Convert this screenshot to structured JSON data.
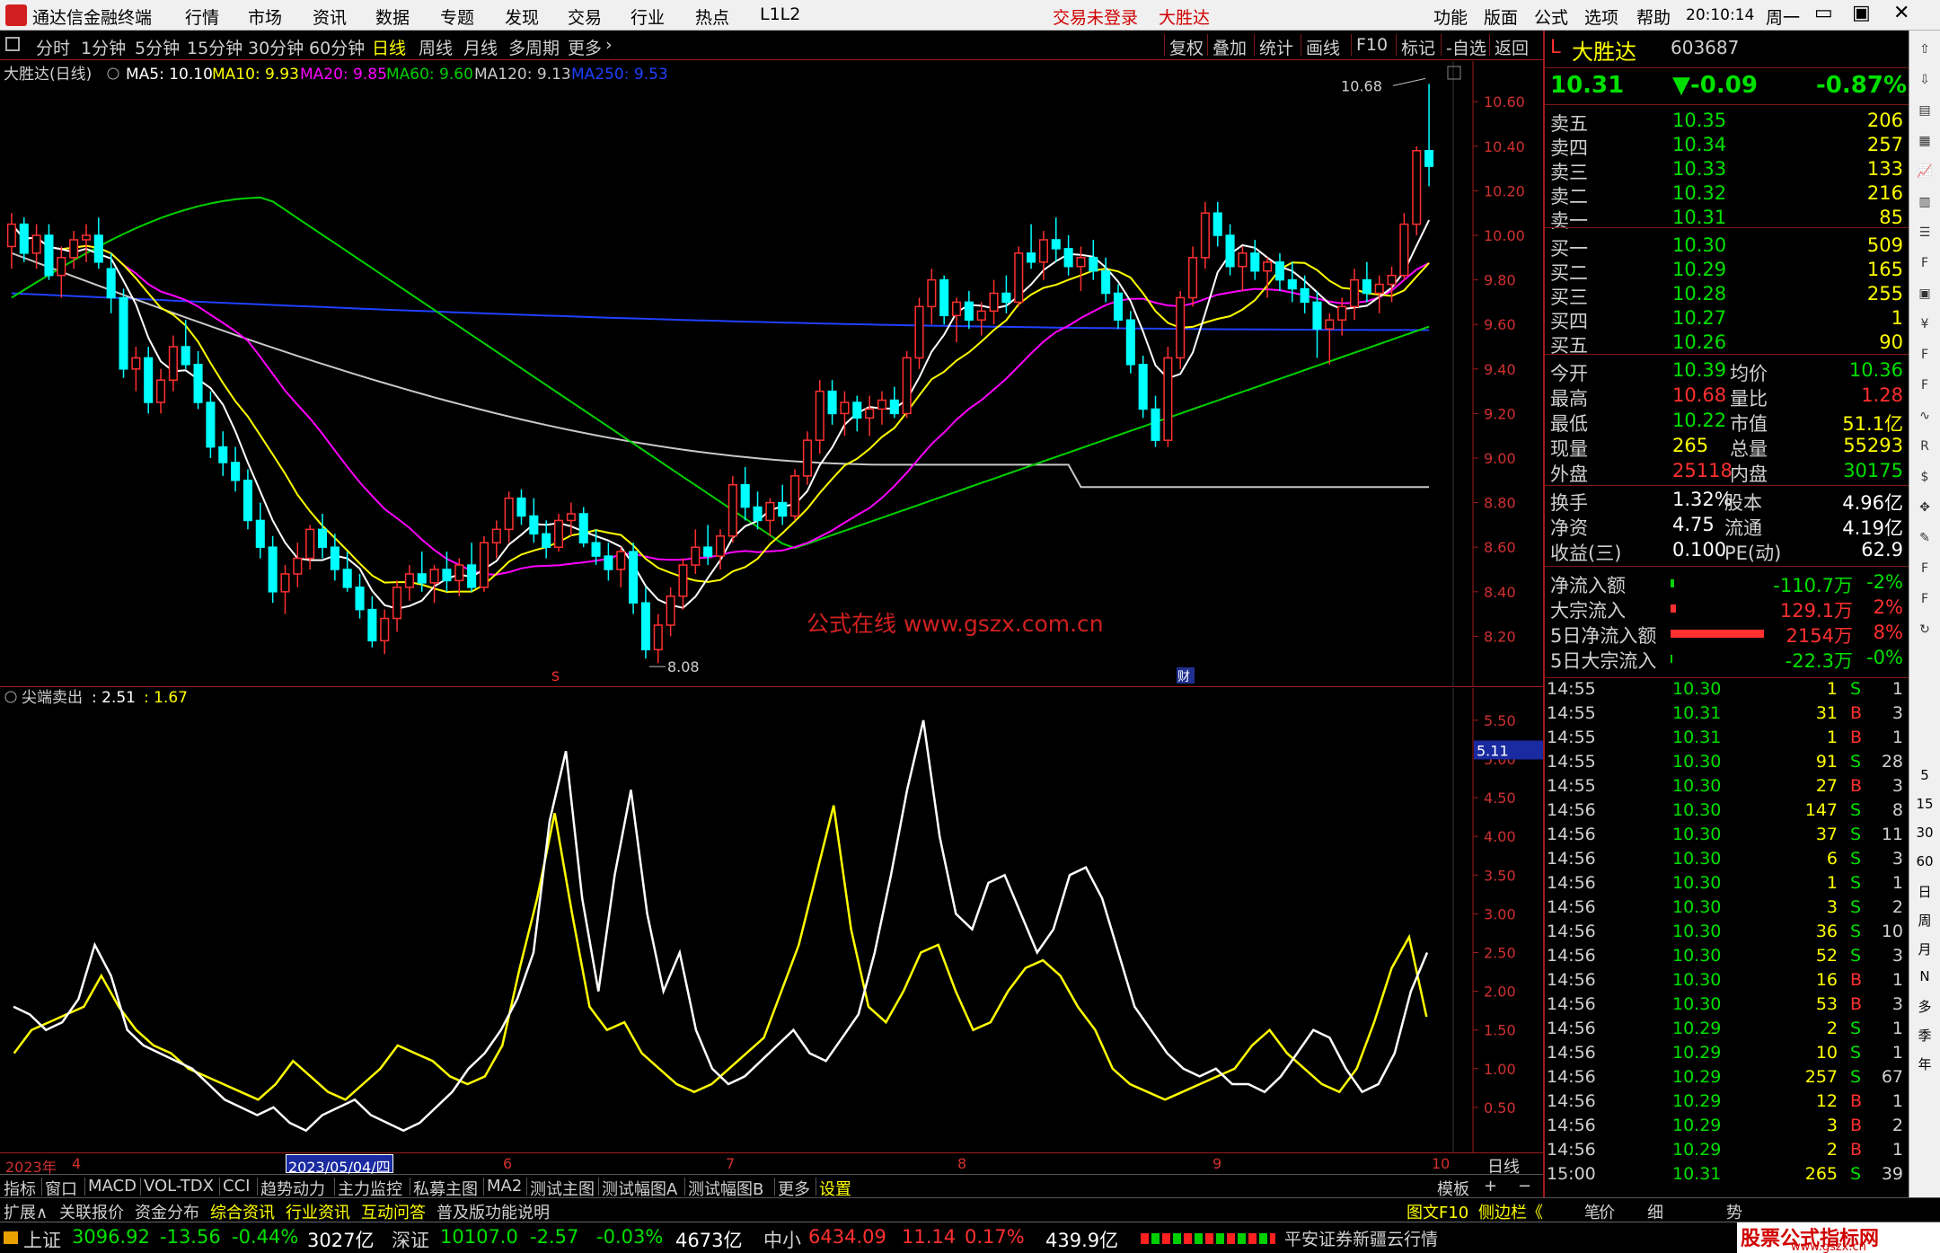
{
  "menubar": {
    "app_title": "通达信金融终端",
    "items": [
      "行情",
      "市场",
      "资讯",
      "数据",
      "专题",
      "发现",
      "交易",
      "行业",
      "热点",
      "L1L2"
    ],
    "status_login": "交易未登录",
    "status_stock": "大胜达",
    "right_items": [
      "功能",
      "版面",
      "公式",
      "选项",
      "帮助"
    ],
    "clock": "20:10:14",
    "weekday": "周一",
    "win_min": "▭",
    "win_max": "▣",
    "win_close": "✕"
  },
  "periodbar": {
    "tabs": [
      "分时",
      "1分钟",
      "5分钟",
      "15分钟",
      "30分钟",
      "60分钟",
      "日线",
      "周线",
      "月线",
      "多周期",
      "更多"
    ],
    "active_index": 6,
    "right_tabs": [
      "复权",
      "叠加",
      "统计",
      "画线",
      "F10",
      "标记",
      "-自选",
      "返回"
    ]
  },
  "main_chart": {
    "legend": {
      "title": "大胜达(日线)",
      "ma5": "MA5: 10.10",
      "ma10": "MA10: 9.93",
      "ma20": "MA20: 9.85",
      "ma60": "MA60: 9.60",
      "ma120": "MA120: 9.13",
      "ma250": "MA250: 9.53"
    },
    "high_label": "10.68",
    "low_label": "8.08",
    "watermark": "公式在线 www.gszx.com.cn",
    "marker_s": "S",
    "marker_cai": "财",
    "y_ticks": [
      "10.60",
      "10.40",
      "10.20",
      "10.00",
      "9.80",
      "9.60",
      "9.40",
      "9.20",
      "9.00",
      "8.80",
      "8.60",
      "8.40",
      "8.20"
    ]
  },
  "indicator": {
    "legend_name": "尖端卖出",
    "legend_v1": ": 2.51",
    "legend_v2": ": 1.67",
    "current_value": "5.11",
    "y_ticks": [
      "5.50",
      "5.00",
      "4.50",
      "4.00",
      "3.50",
      "3.00",
      "2.50",
      "2.00",
      "1.50",
      "1.00",
      "0.50"
    ]
  },
  "xaxis": {
    "labels": [
      "2023年",
      "4",
      "2023/05/04/四",
      "6",
      "7",
      "8",
      "9",
      "10"
    ],
    "period": "日线"
  },
  "bottom_tabs": {
    "items": [
      "指标",
      "窗口",
      "MACD",
      "VOL-TDX",
      "CCI",
      "趋势动力",
      "主力监控",
      "私募主图",
      "MA2",
      "测试主图",
      "测试幅图A",
      "测试幅图B",
      "更多",
      "设置"
    ],
    "right_items": [
      "模板",
      "+",
      "−"
    ]
  },
  "info_tabs": {
    "items": [
      "扩展∧",
      "关联报价",
      "资金分布",
      "综合资讯",
      "行业资讯",
      "互动问答",
      "普及版功能说明"
    ],
    "right_items": [
      "图文F10",
      "侧边栏《",
      "笔",
      "价",
      "细",
      "势"
    ]
  },
  "statusbar": {
    "sh_name": "上证",
    "sh_val": "3096.92",
    "sh_chg": "-13.56",
    "sh_pct": "-0.44%",
    "sh_amt": "3027亿",
    "sz_name": "深证",
    "sz_val": "10107.0",
    "sz_chg": "-2.57",
    "sz_pct": "-0.03%",
    "sz_amt": "4673亿",
    "zx_name": "中小",
    "zx_val": "6434.09",
    "zx_chg": "11.14",
    "zx_pct": "0.17%",
    "zx_amt": "439.9亿",
    "broker": "平安证券新疆云行情",
    "brand": "股票公式指标网",
    "brand_url": "www.gszx.cn"
  },
  "quote": {
    "flag": "L",
    "name": "大胜达",
    "code": "603687",
    "price": "10.31",
    "change": "▼-0.09",
    "pct": "-0.87%",
    "asks": [
      {
        "label": "卖五",
        "price": "10.35",
        "vol": "206"
      },
      {
        "label": "卖四",
        "price": "10.34",
        "vol": "257"
      },
      {
        "label": "卖三",
        "price": "10.33",
        "vol": "133"
      },
      {
        "label": "卖二",
        "price": "10.32",
        "vol": "216"
      },
      {
        "label": "卖一",
        "price": "10.31",
        "vol": "85"
      }
    ],
    "bids": [
      {
        "label": "买一",
        "price": "10.30",
        "vol": "509"
      },
      {
        "label": "买二",
        "price": "10.29",
        "vol": "165"
      },
      {
        "label": "买三",
        "price": "10.28",
        "vol": "255"
      },
      {
        "label": "买四",
        "price": "10.27",
        "vol": "1"
      },
      {
        "label": "买五",
        "price": "10.26",
        "vol": "90"
      }
    ],
    "stats": [
      {
        "l1": "今开",
        "v1": "10.39",
        "l2": "均价",
        "v2": "10.36"
      },
      {
        "l1": "最高",
        "v1": "10.68",
        "l2": "量比",
        "v2": "1.28"
      },
      {
        "l1": "最低",
        "v1": "10.22",
        "l2": "市值",
        "v2": "51.1亿"
      },
      {
        "l1": "现量",
        "v1": "265",
        "l2": "总量",
        "v2": "55293"
      },
      {
        "l1": "外盘",
        "v1": "25118",
        "l2": "内盘",
        "v2": "30175"
      }
    ],
    "fund": [
      {
        "l1": "换手",
        "v1": "1.32%",
        "l2": "股本",
        "v2": "4.96亿"
      },
      {
        "l1": "净资",
        "v1": "4.75",
        "l2": "流通",
        "v2": "4.19亿"
      },
      {
        "l1": "收益(三)",
        "v1": "0.100",
        "l2": "PE(动)",
        "v2": "62.9"
      }
    ],
    "flows": [
      {
        "label": "净流入额",
        "value": "-110.7万",
        "pct": "-2%"
      },
      {
        "label": "大宗流入",
        "value": "129.1万",
        "pct": "2%"
      },
      {
        "label": "5日净流入额",
        "value": "2154万",
        "pct": "8%"
      },
      {
        "label": "5日大宗流入",
        "value": "-22.3万",
        "pct": "-0%"
      }
    ]
  },
  "ticks": [
    {
      "t": "14:55",
      "p": "10.30",
      "v": "1",
      "bs": "S",
      "n": "1"
    },
    {
      "t": "14:55",
      "p": "10.31",
      "v": "31",
      "bs": "B",
      "n": "3"
    },
    {
      "t": "14:55",
      "p": "10.31",
      "v": "1",
      "bs": "B",
      "n": "1"
    },
    {
      "t": "14:55",
      "p": "10.30",
      "v": "91",
      "bs": "S",
      "n": "28"
    },
    {
      "t": "14:55",
      "p": "10.30",
      "v": "27",
      "bs": "B",
      "n": "3"
    },
    {
      "t": "14:56",
      "p": "10.30",
      "v": "147",
      "bs": "S",
      "n": "8"
    },
    {
      "t": "14:56",
      "p": "10.30",
      "v": "37",
      "bs": "S",
      "n": "11"
    },
    {
      "t": "14:56",
      "p": "10.30",
      "v": "6",
      "bs": "S",
      "n": "3"
    },
    {
      "t": "14:56",
      "p": "10.30",
      "v": "1",
      "bs": "S",
      "n": "1"
    },
    {
      "t": "14:56",
      "p": "10.30",
      "v": "3",
      "bs": "S",
      "n": "2"
    },
    {
      "t": "14:56",
      "p": "10.30",
      "v": "36",
      "bs": "S",
      "n": "10"
    },
    {
      "t": "14:56",
      "p": "10.30",
      "v": "52",
      "bs": "S",
      "n": "3"
    },
    {
      "t": "14:56",
      "p": "10.30",
      "v": "16",
      "bs": "B",
      "n": "1"
    },
    {
      "t": "14:56",
      "p": "10.30",
      "v": "53",
      "bs": "B",
      "n": "3"
    },
    {
      "t": "14:56",
      "p": "10.29",
      "v": "2",
      "bs": "S",
      "n": "1"
    },
    {
      "t": "14:56",
      "p": "10.29",
      "v": "10",
      "bs": "S",
      "n": "1"
    },
    {
      "t": "14:56",
      "p": "10.29",
      "v": "257",
      "bs": "S",
      "n": "67"
    },
    {
      "t": "14:56",
      "p": "10.29",
      "v": "12",
      "bs": "B",
      "n": "1"
    },
    {
      "t": "14:56",
      "p": "10.29",
      "v": "3",
      "bs": "B",
      "n": "2"
    },
    {
      "t": "14:56",
      "p": "10.29",
      "v": "2",
      "bs": "B",
      "n": "1"
    },
    {
      "t": "15:00",
      "p": "10.31",
      "v": "265",
      "bs": "S",
      "n": "39"
    }
  ],
  "toolstrip": {
    "icons": [
      "arrow-up-icon",
      "arrow-down-icon",
      "page-icon",
      "grid-icon",
      "chart-icon",
      "kline-icon",
      "list-icon",
      "f10-icon",
      "news-icon",
      "price-icon",
      "f2-icon",
      "f3-icon",
      "wave-icon",
      "rsi-icon",
      "coin-icon",
      "move-icon",
      "pencil-icon",
      "f5-icon",
      "f6-icon",
      "refresh-icon"
    ],
    "periods": [
      "5",
      "15",
      "30",
      "60",
      "日",
      "周",
      "月",
      "N",
      "多",
      "季",
      "年"
    ]
  },
  "colors": {
    "up": "#ff3030",
    "down": "#00ffff",
    "ma5": "#ffffff",
    "ma10": "#ffff00",
    "ma20": "#ff00ff",
    "ma60": "#00d000",
    "ma120": "#c8c8c8",
    "ma250": "#2040ff",
    "ind_white": "#ffffff",
    "ind_yellow": "#ffff00"
  },
  "chart_data": {
    "type": "candlestick",
    "y_range": [
      8.0,
      10.75
    ],
    "ohlc": [
      [
        9.95,
        10.1,
        9.85,
        10.05
      ],
      [
        10.05,
        10.08,
        9.88,
        9.92
      ],
      [
        9.92,
        10.05,
        9.85,
        10.0
      ],
      [
        10.0,
        10.05,
        9.8,
        9.82
      ],
      [
        9.82,
        9.95,
        9.72,
        9.9
      ],
      [
        9.9,
        10.02,
        9.85,
        9.98
      ],
      [
        9.98,
        10.05,
        9.88,
        10.0
      ],
      [
        10.0,
        10.08,
        9.85,
        9.88
      ],
      [
        9.85,
        9.92,
        9.65,
        9.72
      ],
      [
        9.72,
        9.76,
        9.36,
        9.4
      ],
      [
        9.4,
        9.5,
        9.3,
        9.45
      ],
      [
        9.45,
        9.5,
        9.2,
        9.25
      ],
      [
        9.25,
        9.4,
        9.2,
        9.35
      ],
      [
        9.35,
        9.55,
        9.3,
        9.5
      ],
      [
        9.5,
        9.62,
        9.4,
        9.42
      ],
      [
        9.42,
        9.48,
        9.22,
        9.25
      ],
      [
        9.25,
        9.3,
        9.0,
        9.05
      ],
      [
        9.05,
        9.12,
        8.92,
        8.98
      ],
      [
        8.98,
        9.05,
        8.85,
        8.9
      ],
      [
        8.9,
        8.95,
        8.68,
        8.72
      ],
      [
        8.72,
        8.8,
        8.55,
        8.6
      ],
      [
        8.6,
        8.65,
        8.35,
        8.4
      ],
      [
        8.4,
        8.52,
        8.3,
        8.48
      ],
      [
        8.48,
        8.62,
        8.42,
        8.55
      ],
      [
        8.55,
        8.7,
        8.5,
        8.68
      ],
      [
        8.68,
        8.75,
        8.55,
        8.6
      ],
      [
        8.6,
        8.66,
        8.45,
        8.5
      ],
      [
        8.5,
        8.58,
        8.4,
        8.42
      ],
      [
        8.42,
        8.48,
        8.28,
        8.32
      ],
      [
        8.32,
        8.38,
        8.15,
        8.18
      ],
      [
        8.18,
        8.32,
        8.12,
        8.28
      ],
      [
        8.28,
        8.45,
        8.22,
        8.42
      ],
      [
        8.42,
        8.52,
        8.36,
        8.48
      ],
      [
        8.48,
        8.58,
        8.4,
        8.44
      ],
      [
        8.44,
        8.52,
        8.35,
        8.5
      ],
      [
        8.5,
        8.58,
        8.4,
        8.45
      ],
      [
        8.45,
        8.55,
        8.38,
        8.52
      ],
      [
        8.52,
        8.62,
        8.4,
        8.42
      ],
      [
        8.42,
        8.65,
        8.4,
        8.62
      ],
      [
        8.62,
        8.72,
        8.55,
        8.68
      ],
      [
        8.68,
        8.85,
        8.62,
        8.82
      ],
      [
        8.82,
        8.86,
        8.7,
        8.74
      ],
      [
        8.74,
        8.82,
        8.62,
        8.66
      ],
      [
        8.66,
        8.72,
        8.55,
        8.6
      ],
      [
        8.6,
        8.75,
        8.58,
        8.72
      ],
      [
        8.72,
        8.8,
        8.65,
        8.75
      ],
      [
        8.75,
        8.78,
        8.6,
        8.62
      ],
      [
        8.62,
        8.68,
        8.52,
        8.56
      ],
      [
        8.56,
        8.62,
        8.45,
        8.5
      ],
      [
        8.5,
        8.6,
        8.42,
        8.58
      ],
      [
        8.58,
        8.62,
        8.3,
        8.35
      ],
      [
        8.35,
        8.42,
        8.1,
        8.14
      ],
      [
        8.14,
        8.3,
        8.08,
        8.25
      ],
      [
        8.25,
        8.42,
        8.2,
        8.38
      ],
      [
        8.38,
        8.55,
        8.32,
        8.52
      ],
      [
        8.52,
        8.68,
        8.48,
        8.6
      ],
      [
        8.6,
        8.7,
        8.52,
        8.56
      ],
      [
        8.56,
        8.68,
        8.5,
        8.65
      ],
      [
        8.65,
        8.92,
        8.62,
        8.88
      ],
      [
        8.88,
        8.96,
        8.72,
        8.78
      ],
      [
        8.78,
        8.85,
        8.68,
        8.72
      ],
      [
        8.72,
        8.82,
        8.65,
        8.8
      ],
      [
        8.8,
        8.88,
        8.7,
        8.74
      ],
      [
        8.74,
        8.95,
        8.72,
        8.92
      ],
      [
        8.92,
        9.12,
        8.88,
        9.08
      ],
      [
        9.08,
        9.35,
        9.02,
        9.3
      ],
      [
        9.3,
        9.35,
        9.15,
        9.2
      ],
      [
        9.2,
        9.3,
        9.1,
        9.25
      ],
      [
        9.25,
        9.28,
        9.12,
        9.18
      ],
      [
        9.18,
        9.28,
        9.1,
        9.22
      ],
      [
        9.22,
        9.3,
        9.15,
        9.26
      ],
      [
        9.26,
        9.32,
        9.18,
        9.2
      ],
      [
        9.2,
        9.48,
        9.18,
        9.45
      ],
      [
        9.45,
        9.72,
        9.4,
        9.68
      ],
      [
        9.68,
        9.85,
        9.6,
        9.8
      ],
      [
        9.8,
        9.82,
        9.6,
        9.64
      ],
      [
        9.64,
        9.72,
        9.52,
        9.7
      ],
      [
        9.7,
        9.75,
        9.58,
        9.62
      ],
      [
        9.62,
        9.7,
        9.55,
        9.66
      ],
      [
        9.66,
        9.8,
        9.6,
        9.74
      ],
      [
        9.74,
        9.82,
        9.65,
        9.7
      ],
      [
        9.7,
        9.95,
        9.68,
        9.92
      ],
      [
        9.92,
        10.05,
        9.85,
        9.88
      ],
      [
        9.88,
        10.02,
        9.8,
        9.98
      ],
      [
        9.98,
        10.08,
        9.88,
        9.94
      ],
      [
        9.94,
        10.0,
        9.82,
        9.86
      ],
      [
        9.86,
        9.95,
        9.75,
        9.9
      ],
      [
        9.9,
        9.98,
        9.8,
        9.84
      ],
      [
        9.84,
        9.9,
        9.7,
        9.74
      ],
      [
        9.74,
        9.78,
        9.58,
        9.62
      ],
      [
        9.62,
        9.66,
        9.38,
        9.42
      ],
      [
        9.42,
        9.46,
        9.18,
        9.22
      ],
      [
        9.22,
        9.28,
        9.05,
        9.08
      ],
      [
        9.08,
        9.5,
        9.05,
        9.45
      ],
      [
        9.45,
        9.75,
        9.4,
        9.72
      ],
      [
        9.72,
        9.95,
        9.68,
        9.9
      ],
      [
        9.9,
        10.15,
        9.85,
        10.1
      ],
      [
        10.1,
        10.15,
        9.95,
        10.0
      ],
      [
        10.0,
        10.05,
        9.82,
        9.86
      ],
      [
        9.86,
        9.95,
        9.75,
        9.92
      ],
      [
        9.92,
        9.98,
        9.8,
        9.84
      ],
      [
        9.84,
        9.9,
        9.72,
        9.88
      ],
      [
        9.88,
        9.92,
        9.75,
        9.8
      ],
      [
        9.8,
        9.88,
        9.7,
        9.76
      ],
      [
        9.76,
        9.82,
        9.65,
        9.7
      ],
      [
        9.7,
        9.75,
        9.45,
        9.58
      ],
      [
        9.58,
        9.65,
        9.42,
        9.62
      ],
      [
        9.62,
        9.72,
        9.55,
        9.68
      ],
      [
        9.68,
        9.85,
        9.62,
        9.8
      ],
      [
        9.8,
        9.88,
        9.7,
        9.74
      ],
      [
        9.74,
        9.82,
        9.65,
        9.78
      ],
      [
        9.78,
        9.86,
        9.7,
        9.82
      ],
      [
        9.82,
        10.1,
        9.8,
        10.05
      ],
      [
        10.05,
        10.4,
        10.0,
        10.38
      ],
      [
        10.38,
        10.68,
        10.22,
        10.31
      ]
    ],
    "ind_white": [
      1.8,
      1.7,
      1.5,
      1.6,
      1.9,
      2.6,
      2.2,
      1.5,
      1.3,
      1.2,
      1.1,
      1.0,
      0.8,
      0.6,
      0.5,
      0.4,
      0.5,
      0.3,
      0.2,
      0.4,
      0.5,
      0.6,
      0.4,
      0.3,
      0.2,
      0.3,
      0.5,
      0.7,
      1.0,
      1.2,
      1.5,
      1.9,
      2.5,
      4.2,
      5.1,
      3.2,
      2.0,
      3.5,
      4.6,
      3.0,
      2.0,
      2.5,
      1.5,
      1.0,
      0.8,
      0.9,
      1.1,
      1.3,
      1.5,
      1.2,
      1.1,
      1.4,
      1.7,
      2.5,
      3.5,
      4.6,
      5.5,
      4.0,
      3.0,
      2.8,
      3.4,
      3.5,
      3.0,
      2.5,
      2.8,
      3.5,
      3.6,
      3.2,
      2.5,
      1.8,
      1.5,
      1.2,
      1.0,
      0.9,
      1.0,
      0.8,
      0.8,
      0.7,
      0.9,
      1.2,
      1.5,
      1.4,
      1.0,
      0.7,
      0.8,
      1.2,
      2.0,
      2.5
    ],
    "ind_yellow": [
      1.2,
      1.5,
      1.6,
      1.7,
      1.8,
      2.2,
      1.8,
      1.5,
      1.3,
      1.2,
      1.0,
      0.9,
      0.8,
      0.7,
      0.6,
      0.8,
      1.1,
      0.9,
      0.7,
      0.6,
      0.8,
      1.0,
      1.3,
      1.2,
      1.1,
      0.9,
      0.8,
      0.9,
      1.3,
      2.3,
      3.2,
      4.3,
      3.0,
      1.8,
      1.5,
      1.6,
      1.2,
      1.0,
      0.8,
      0.7,
      0.8,
      1.0,
      1.2,
      1.4,
      2.0,
      2.6,
      3.5,
      4.4,
      2.8,
      1.8,
      1.6,
      2.0,
      2.5,
      2.6,
      2.0,
      1.5,
      1.6,
      2.0,
      2.3,
      2.4,
      2.2,
      1.8,
      1.5,
      1.0,
      0.8,
      0.7,
      0.6,
      0.7,
      0.8,
      0.9,
      1.0,
      1.3,
      1.5,
      1.2,
      1.0,
      0.8,
      0.7,
      1.0,
      1.6,
      2.3,
      2.7,
      1.67
    ]
  }
}
